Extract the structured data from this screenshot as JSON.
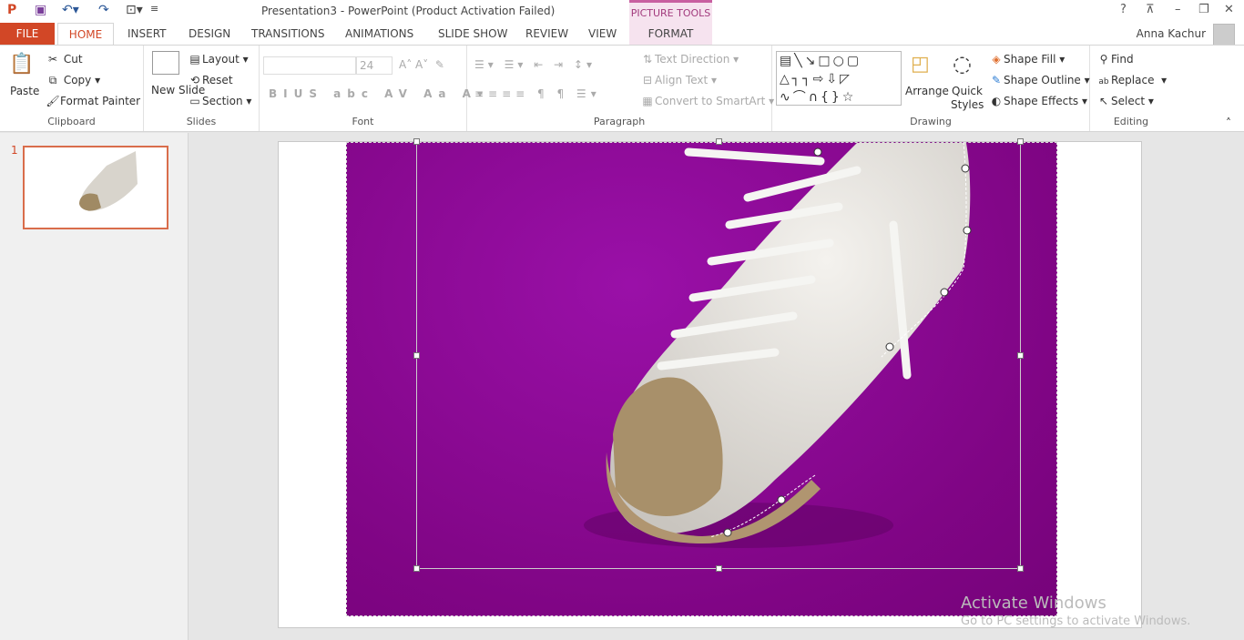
{
  "window": {
    "title": "Presentation3 - PowerPoint (Product Activation Failed)",
    "context_tab_group": "PICTURE TOOLS",
    "user": "Anna Kachur"
  },
  "tabs": [
    "FILE",
    "HOME",
    "INSERT",
    "DESIGN",
    "TRANSITIONS",
    "ANIMATIONS",
    "SLIDE SHOW",
    "REVIEW",
    "VIEW",
    "FORMAT"
  ],
  "ribbon": {
    "clipboard": {
      "label": "Clipboard",
      "paste": "Paste",
      "cut": "Cut",
      "copy": "Copy",
      "format_painter": "Format Painter"
    },
    "slides": {
      "label": "Slides",
      "new_slide": "New Slide",
      "layout": "Layout",
      "reset": "Reset",
      "section": "Section"
    },
    "font": {
      "label": "Font",
      "font_name": "",
      "font_size": "24"
    },
    "paragraph": {
      "label": "Paragraph",
      "text_direction": "Text Direction",
      "align_text": "Align Text",
      "convert_smartart": "Convert to SmartArt"
    },
    "drawing": {
      "label": "Drawing",
      "arrange": "Arrange",
      "quick_styles": "Quick Styles",
      "shape_fill": "Shape Fill",
      "shape_outline": "Shape Outline",
      "shape_effects": "Shape Effects"
    },
    "editing": {
      "label": "Editing",
      "find": "Find",
      "replace": "Replace",
      "select": "Select"
    }
  },
  "thumbnails": [
    {
      "number": "1"
    }
  ],
  "watermark": {
    "line1": "Activate Windows",
    "line2": "Go to PC settings to activate Windows."
  },
  "colors": {
    "accent": "#d24726",
    "picture_bg": "#8a0a96"
  }
}
